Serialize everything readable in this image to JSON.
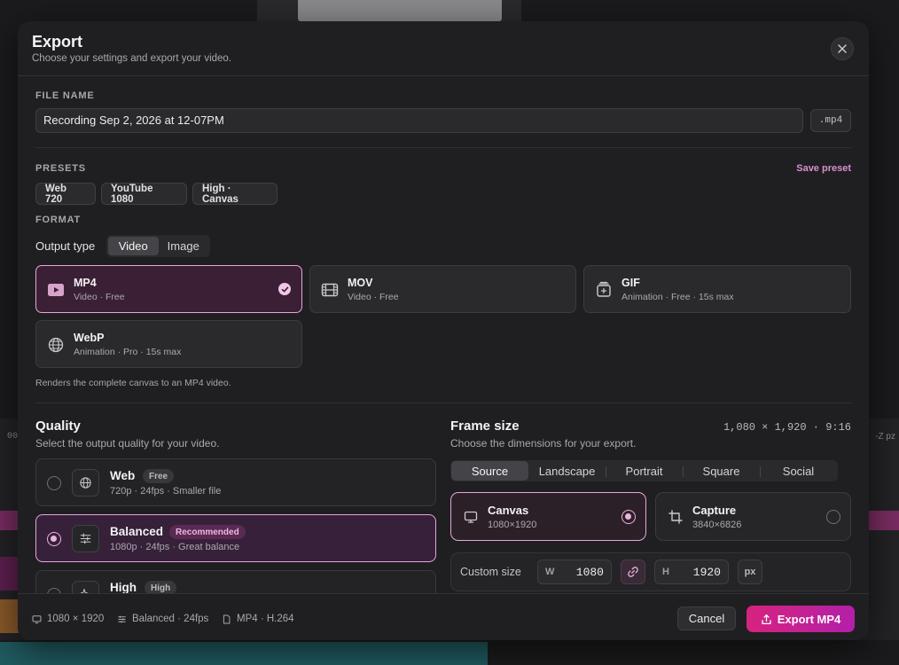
{
  "background": {
    "timeline_left_text": "00",
    "timeline_right_text": "-Z pz"
  },
  "dialog": {
    "title": "Export",
    "subtitle": "Choose your settings and export your video.",
    "close_icon": "close-icon"
  },
  "file_name": {
    "label": "FILE NAME",
    "value": "Recording Sep 2, 2026 at 12-07PM",
    "extension": ".mp4"
  },
  "presets": {
    "label": "PRESETS",
    "save_label": "Save preset",
    "items": [
      {
        "label": "Web 720"
      },
      {
        "label": "YouTube 1080"
      },
      {
        "label": "High · Canvas"
      }
    ]
  },
  "format": {
    "label": "FORMAT",
    "output_type_label": "Output type",
    "output_types": [
      "Video",
      "Image"
    ],
    "output_type_selected": "Video",
    "options": [
      {
        "title": "MP4",
        "sub": "Video · Free",
        "icon": "play-icon",
        "selected": true
      },
      {
        "title": "MOV",
        "sub": "Video · Free",
        "icon": "film-icon",
        "selected": false
      },
      {
        "title": "GIF",
        "sub": "Animation · Free · 15s max",
        "icon": "gif-icon",
        "selected": false
      },
      {
        "title": "WebP",
        "sub": "Animation · Pro · 15s max",
        "icon": "globe-icon",
        "selected": false
      }
    ],
    "hint": "Renders the complete canvas to an MP4 video."
  },
  "quality": {
    "title": "Quality",
    "subtitle": "Select the output quality for your video.",
    "options": [
      {
        "title": "Web",
        "badge": "Free",
        "badge_style": "gray",
        "sub": "720p · 24fps · Smaller file",
        "icon": "globe-icon",
        "selected": false
      },
      {
        "title": "Balanced",
        "badge": "Recommended",
        "badge_style": "pink",
        "sub": "1080p · 24fps · Great balance",
        "icon": "sliders-icon",
        "selected": true
      },
      {
        "title": "High",
        "badge": "High",
        "badge_style": "gray",
        "sub": "",
        "icon": "sparkle-icon",
        "selected": false
      }
    ]
  },
  "frame_size": {
    "title": "Frame size",
    "subtitle": "Choose the dimensions for your export.",
    "dimensions": "1,080 × 1,920 · 9:16",
    "tabs": [
      "Source",
      "Landscape",
      "Portrait",
      "Square",
      "Social"
    ],
    "active_tab": "Source",
    "sources": [
      {
        "title": "Canvas",
        "sub": "1080×1920",
        "icon": "monitor-icon",
        "selected": true
      },
      {
        "title": "Capture",
        "sub": "3840×6826",
        "icon": "crop-icon",
        "selected": false
      }
    ],
    "custom_label": "Custom size",
    "width_prefix": "W",
    "width_value": "1080",
    "height_prefix": "H",
    "height_value": "1920",
    "unit": "px"
  },
  "footer": {
    "resolution": "1080 × 1920",
    "quality": "Balanced · 24fps",
    "codec": "MP4 · H.264",
    "cancel_label": "Cancel",
    "export_label": "Export MP4"
  },
  "colors": {
    "accent": "#e6a6d9",
    "export_gradient_start": "#d6237f",
    "export_gradient_end": "#b220a8"
  }
}
